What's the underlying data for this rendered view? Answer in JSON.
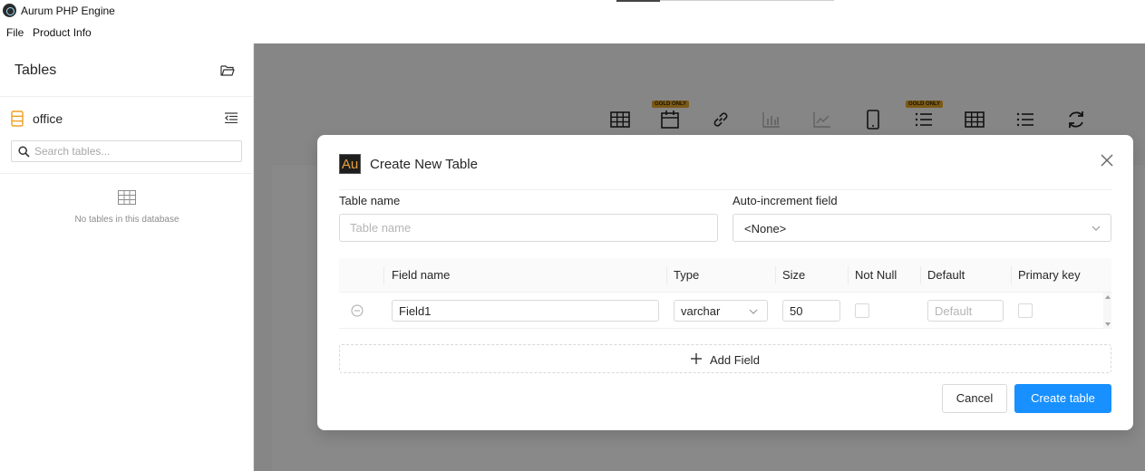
{
  "window": {
    "title": "Aurum PHP Engine"
  },
  "menu": {
    "items": [
      "File",
      "Product Info"
    ]
  },
  "sidebar": {
    "title": "Tables",
    "database": "office",
    "search_placeholder": "Search tables...",
    "empty_text": "No tables in this database"
  },
  "toolbar": {
    "icons": [
      "table-icon",
      "calendar-icon",
      "link-icon",
      "bar-chart-icon",
      "line-chart-icon",
      "mobile-icon",
      "list-icon",
      "grid-icon",
      "list-icon",
      "refresh-icon"
    ],
    "gold_badge": "GOLD ONLY"
  },
  "modal": {
    "logo_text": "Au",
    "title": "Create New Table",
    "table_name_label": "Table name",
    "table_name_placeholder": "Table name",
    "table_name_value": "",
    "auto_increment_label": "Auto-increment field",
    "auto_increment_value": "<None>",
    "columns": [
      "Field name",
      "Type",
      "Size",
      "Not Null",
      "Default",
      "Primary key"
    ],
    "fields": [
      {
        "name": "Field1",
        "type": "varchar",
        "size": "50",
        "not_null": false,
        "default_placeholder": "Default",
        "primary_key": false
      }
    ],
    "add_field_label": "Add Field",
    "cancel_label": "Cancel",
    "create_label": "Create table"
  },
  "colors": {
    "primary": "#1890ff",
    "gold": "#e0a52a",
    "overlay": "rgba(0,0,0,0.45)"
  }
}
